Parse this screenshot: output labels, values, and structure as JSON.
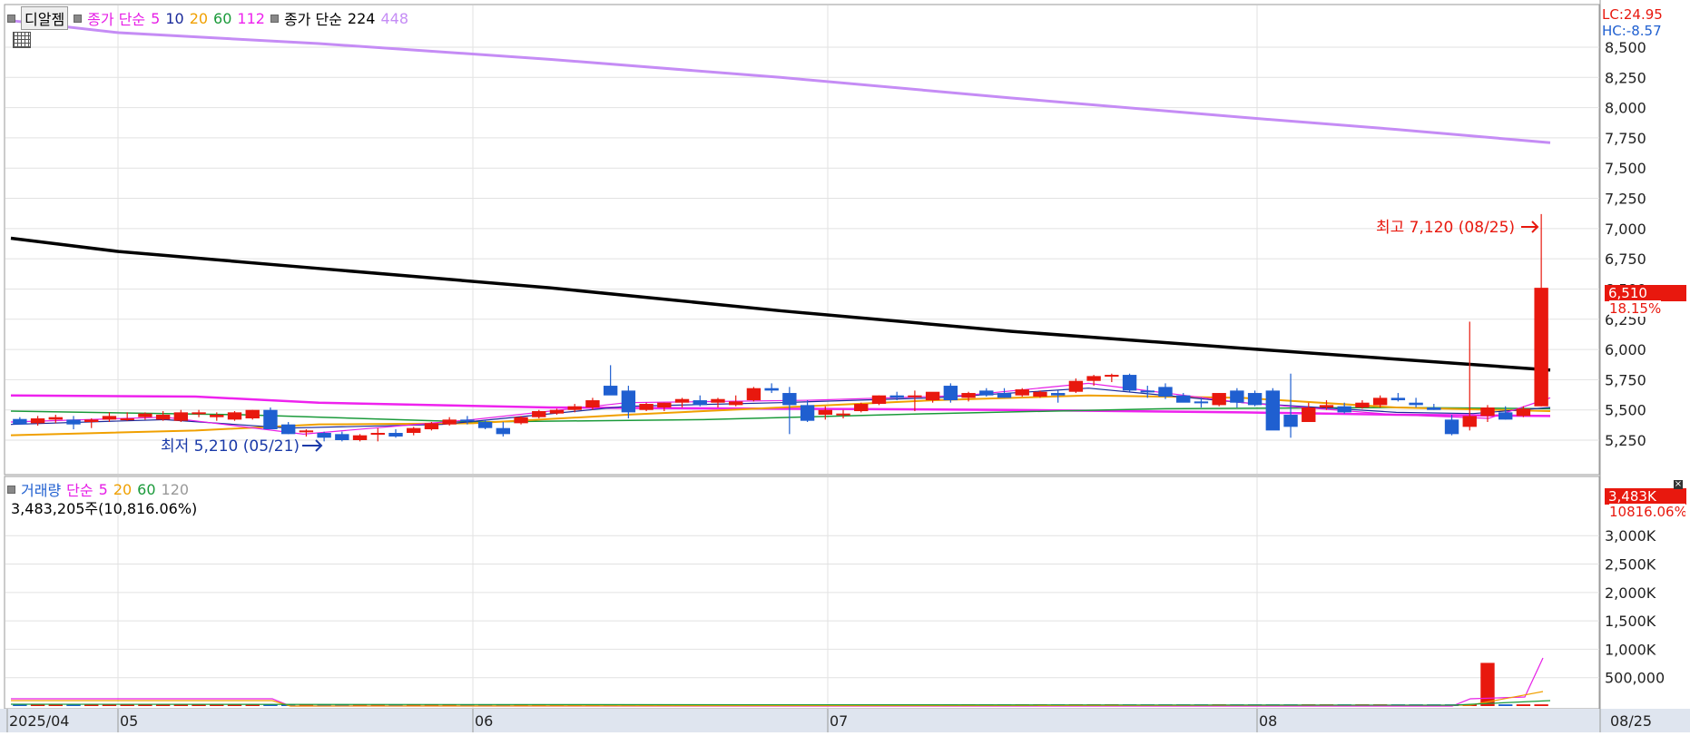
{
  "header": {
    "stock_name": "디알젬",
    "ma_label": "종가 단순",
    "ma_periods": [
      "5",
      "10",
      "20",
      "60",
      "112"
    ],
    "ma_label2": "종가 단순",
    "ma_periods2": [
      "224",
      "448"
    ],
    "lc": "LC:24.95",
    "hc": "HC:-8.57"
  },
  "volume_header": {
    "title": "거래량",
    "ma_label": "단순",
    "periods": [
      "5",
      "20",
      "60",
      "120"
    ],
    "current": "3,483,205주(10,816.06%)"
  },
  "annotations": {
    "high": "최고 7,120 (08/25)",
    "low": "최저 5,210 (05/21)"
  },
  "price_tag": {
    "price": "6,510",
    "change": "18.15%"
  },
  "volume_tag": {
    "value": "3,483K",
    "change": "10816.06%"
  },
  "x_labels": [
    "2025/04",
    "05",
    "06",
    "07",
    "08"
  ],
  "x_last_label": "08/25",
  "colors": {
    "up": "#e8180e",
    "down": "#1f5fd0",
    "ma5": "#e61ee6",
    "ma10": "#1a2a9a",
    "ma20": "#f0a000",
    "ma60": "#1a9a3a",
    "ma112": "#ee22ee",
    "ma224": "#000000",
    "ma448": "#c58cf5"
  },
  "chart_data": [
    {
      "type": "candlestick",
      "title": "디알젬",
      "y_ticks": [
        5250,
        5500,
        5750,
        6000,
        6250,
        6500,
        6750,
        7000,
        7250,
        7500,
        7750,
        8000,
        8250,
        8500
      ],
      "ylim": [
        5050,
        8700
      ],
      "x_ticks": [
        "2025/04",
        "05",
        "06",
        "07",
        "08",
        "08/25"
      ],
      "candles": [
        [
          5425,
          5440,
          5380,
          5380
        ],
        [
          5390,
          5450,
          5370,
          5430
        ],
        [
          5420,
          5460,
          5390,
          5440
        ],
        [
          5420,
          5450,
          5340,
          5380
        ],
        [
          5400,
          5430,
          5350,
          5420
        ],
        [
          5420,
          5480,
          5400,
          5450
        ],
        [
          5430,
          5480,
          5410,
          5430
        ],
        [
          5440,
          5480,
          5420,
          5470
        ],
        [
          5420,
          5490,
          5410,
          5460
        ],
        [
          5410,
          5500,
          5400,
          5480
        ],
        [
          5470,
          5500,
          5440,
          5480
        ],
        [
          5440,
          5480,
          5410,
          5460
        ],
        [
          5420,
          5490,
          5410,
          5480
        ],
        [
          5430,
          5500,
          5420,
          5500
        ],
        [
          5500,
          5520,
          5350,
          5340
        ],
        [
          5380,
          5400,
          5300,
          5300
        ],
        [
          5320,
          5340,
          5280,
          5330
        ],
        [
          5310,
          5320,
          5240,
          5270
        ],
        [
          5300,
          5320,
          5240,
          5250
        ],
        [
          5250,
          5300,
          5240,
          5290
        ],
        [
          5300,
          5350,
          5240,
          5310
        ],
        [
          5310,
          5340,
          5270,
          5280
        ],
        [
          5310,
          5360,
          5290,
          5350
        ],
        [
          5340,
          5400,
          5330,
          5390
        ],
        [
          5380,
          5440,
          5370,
          5420
        ],
        [
          5420,
          5450,
          5380,
          5410
        ],
        [
          5400,
          5420,
          5340,
          5350
        ],
        [
          5350,
          5400,
          5280,
          5300
        ],
        [
          5390,
          5450,
          5380,
          5440
        ],
        [
          5440,
          5500,
          5430,
          5490
        ],
        [
          5470,
          5510,
          5460,
          5500
        ],
        [
          5500,
          5550,
          5480,
          5530
        ],
        [
          5520,
          5600,
          5500,
          5580
        ],
        [
          5700,
          5870,
          5640,
          5620
        ],
        [
          5660,
          5700,
          5430,
          5480
        ],
        [
          5500,
          5560,
          5490,
          5550
        ],
        [
          5520,
          5560,
          5490,
          5560
        ],
        [
          5560,
          5600,
          5520,
          5590
        ],
        [
          5580,
          5620,
          5530,
          5540
        ],
        [
          5560,
          5600,
          5520,
          5590
        ],
        [
          5540,
          5620,
          5530,
          5570
        ],
        [
          5580,
          5690,
          5570,
          5680
        ],
        [
          5680,
          5720,
          5640,
          5660
        ],
        [
          5640,
          5690,
          5300,
          5540
        ],
        [
          5540,
          5580,
          5400,
          5410
        ],
        [
          5460,
          5530,
          5420,
          5500
        ],
        [
          5470,
          5500,
          5430,
          5470
        ],
        [
          5490,
          5560,
          5480,
          5550
        ],
        [
          5550,
          5620,
          5540,
          5620
        ],
        [
          5620,
          5650,
          5580,
          5600
        ],
        [
          5610,
          5660,
          5490,
          5620
        ],
        [
          5580,
          5640,
          5560,
          5650
        ],
        [
          5700,
          5720,
          5560,
          5580
        ],
        [
          5600,
          5650,
          5570,
          5640
        ],
        [
          5660,
          5680,
          5610,
          5620
        ],
        [
          5640,
          5680,
          5600,
          5600
        ],
        [
          5620,
          5680,
          5610,
          5670
        ],
        [
          5610,
          5660,
          5600,
          5650
        ],
        [
          5640,
          5660,
          5560,
          5620
        ],
        [
          5650,
          5760,
          5640,
          5740
        ],
        [
          5740,
          5790,
          5700,
          5780
        ],
        [
          5780,
          5800,
          5730,
          5790
        ],
        [
          5790,
          5800,
          5650,
          5660
        ],
        [
          5660,
          5700,
          5600,
          5650
        ],
        [
          5690,
          5720,
          5590,
          5610
        ],
        [
          5620,
          5640,
          5570,
          5560
        ],
        [
          5570,
          5600,
          5520,
          5560
        ],
        [
          5540,
          5640,
          5530,
          5640
        ],
        [
          5660,
          5680,
          5520,
          5560
        ],
        [
          5640,
          5660,
          5530,
          5540
        ],
        [
          5660,
          5680,
          5430,
          5330
        ],
        [
          5460,
          5800,
          5270,
          5360
        ],
        [
          5400,
          5560,
          5420,
          5520
        ],
        [
          5520,
          5580,
          5500,
          5540
        ],
        [
          5530,
          5560,
          5470,
          5480
        ],
        [
          5520,
          5580,
          5510,
          5560
        ],
        [
          5540,
          5620,
          5520,
          5600
        ],
        [
          5600,
          5640,
          5570,
          5580
        ],
        [
          5560,
          5600,
          5520,
          5540
        ],
        [
          5520,
          5550,
          5500,
          5500
        ],
        [
          5420,
          5460,
          5290,
          5300
        ],
        [
          5360,
          6230,
          5330,
          5450
        ],
        [
          5450,
          5540,
          5400,
          5520
        ],
        [
          5480,
          5530,
          5420,
          5420
        ],
        [
          5450,
          5530,
          5440,
          5510
        ],
        [
          5530,
          7120,
          5530,
          6510
        ]
      ],
      "ma": {
        "ma448": [
          [
            0,
            8720
          ],
          [
            0.07,
            8620
          ],
          [
            0.2,
            8530
          ],
          [
            0.35,
            8400
          ],
          [
            0.5,
            8250
          ],
          [
            0.65,
            8080
          ],
          [
            0.8,
            7920
          ],
          [
            0.9,
            7820
          ],
          [
            1,
            7710
          ]
        ],
        "ma224": [
          [
            0,
            6920
          ],
          [
            0.07,
            6810
          ],
          [
            0.2,
            6670
          ],
          [
            0.35,
            6510
          ],
          [
            0.5,
            6320
          ],
          [
            0.65,
            6150
          ],
          [
            0.8,
            6010
          ],
          [
            0.9,
            5920
          ],
          [
            1,
            5830
          ]
        ],
        "ma112": [
          [
            0,
            5620
          ],
          [
            0.12,
            5610
          ],
          [
            0.2,
            5560
          ],
          [
            0.35,
            5520
          ],
          [
            0.5,
            5510
          ],
          [
            0.65,
            5500
          ],
          [
            0.8,
            5480
          ],
          [
            0.9,
            5460
          ],
          [
            1,
            5450
          ]
        ],
        "ma60": [
          [
            0,
            5490
          ],
          [
            0.15,
            5460
          ],
          [
            0.3,
            5400
          ],
          [
            0.45,
            5420
          ],
          [
            0.6,
            5470
          ],
          [
            0.75,
            5510
          ],
          [
            0.9,
            5520
          ],
          [
            1,
            5510
          ]
        ],
        "ma20": [
          [
            0,
            5290
          ],
          [
            0.12,
            5330
          ],
          [
            0.2,
            5380
          ],
          [
            0.3,
            5390
          ],
          [
            0.4,
            5460
          ],
          [
            0.5,
            5520
          ],
          [
            0.6,
            5580
          ],
          [
            0.7,
            5620
          ],
          [
            0.8,
            5600
          ],
          [
            0.9,
            5520
          ],
          [
            1,
            5490
          ]
        ],
        "ma10": [
          [
            0,
            5380
          ],
          [
            0.1,
            5420
          ],
          [
            0.18,
            5350
          ],
          [
            0.28,
            5380
          ],
          [
            0.4,
            5530
          ],
          [
            0.5,
            5560
          ],
          [
            0.6,
            5600
          ],
          [
            0.7,
            5680
          ],
          [
            0.8,
            5560
          ],
          [
            0.9,
            5480
          ],
          [
            0.95,
            5470
          ],
          [
            1,
            5520
          ]
        ],
        "ma5": [
          [
            0,
            5400
          ],
          [
            0.1,
            5440
          ],
          [
            0.19,
            5300
          ],
          [
            0.3,
            5420
          ],
          [
            0.4,
            5560
          ],
          [
            0.52,
            5580
          ],
          [
            0.62,
            5620
          ],
          [
            0.7,
            5720
          ],
          [
            0.8,
            5560
          ],
          [
            0.9,
            5460
          ],
          [
            0.96,
            5430
          ],
          [
            1,
            5600
          ]
        ]
      }
    },
    {
      "type": "bar",
      "title": "거래량",
      "y_ticks": [
        "500,000",
        "1,000K",
        "1,500K",
        "2,000K",
        "2,500K",
        "3,000K"
      ],
      "ylim": [
        0,
        3483205
      ],
      "bars_note": "daily volume, last two spikes visible",
      "spikes": [
        {
          "index": 82,
          "value": 760000
        },
        {
          "index": 87,
          "value": 3483205
        }
      ],
      "base_value": 30000
    }
  ]
}
